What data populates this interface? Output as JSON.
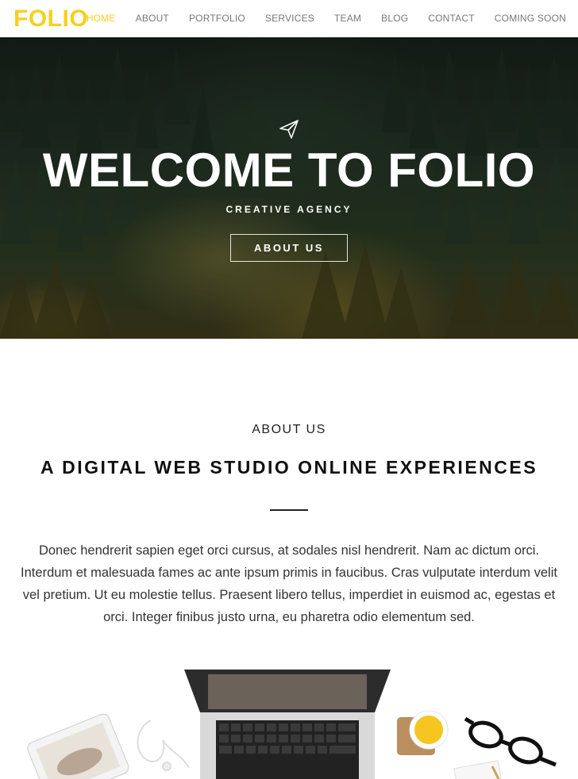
{
  "nav": {
    "logo": "FOLIO",
    "items": [
      {
        "label": "HOME",
        "active": true
      },
      {
        "label": "ABOUT"
      },
      {
        "label": "PORTFOLIO"
      },
      {
        "label": "SERVICES"
      },
      {
        "label": "TEAM"
      },
      {
        "label": "BLOG"
      },
      {
        "label": "CONTACT"
      },
      {
        "label": "COMING SOON"
      }
    ]
  },
  "hero": {
    "icon": "paper-plane-icon",
    "title": "WELCOME TO FOLIO",
    "subtitle": "CREATIVE AGENCY",
    "button_label": "ABOUT US"
  },
  "about": {
    "label": "ABOUT US",
    "heading": "A DIGITAL WEB STUDIO ONLINE EXPERIENCES",
    "text": "Donec hendrerit sapien eget orci cursus, at sodales nisl hendrerit. Nam ac dictum orci. Interdum et malesuada fames ac ante ipsum primis in faucibus. Cras vulputate interdum velit vel pretium. Ut eu molestie tellus. Praesent libero tellus, imperdiet in euismod ac, egestas et orci. Integer finibus justo urna, eu pharetra odio elementum sed."
  },
  "colors": {
    "brand": "#f7cf1f",
    "nav_text": "#777777",
    "heading": "#111111"
  }
}
